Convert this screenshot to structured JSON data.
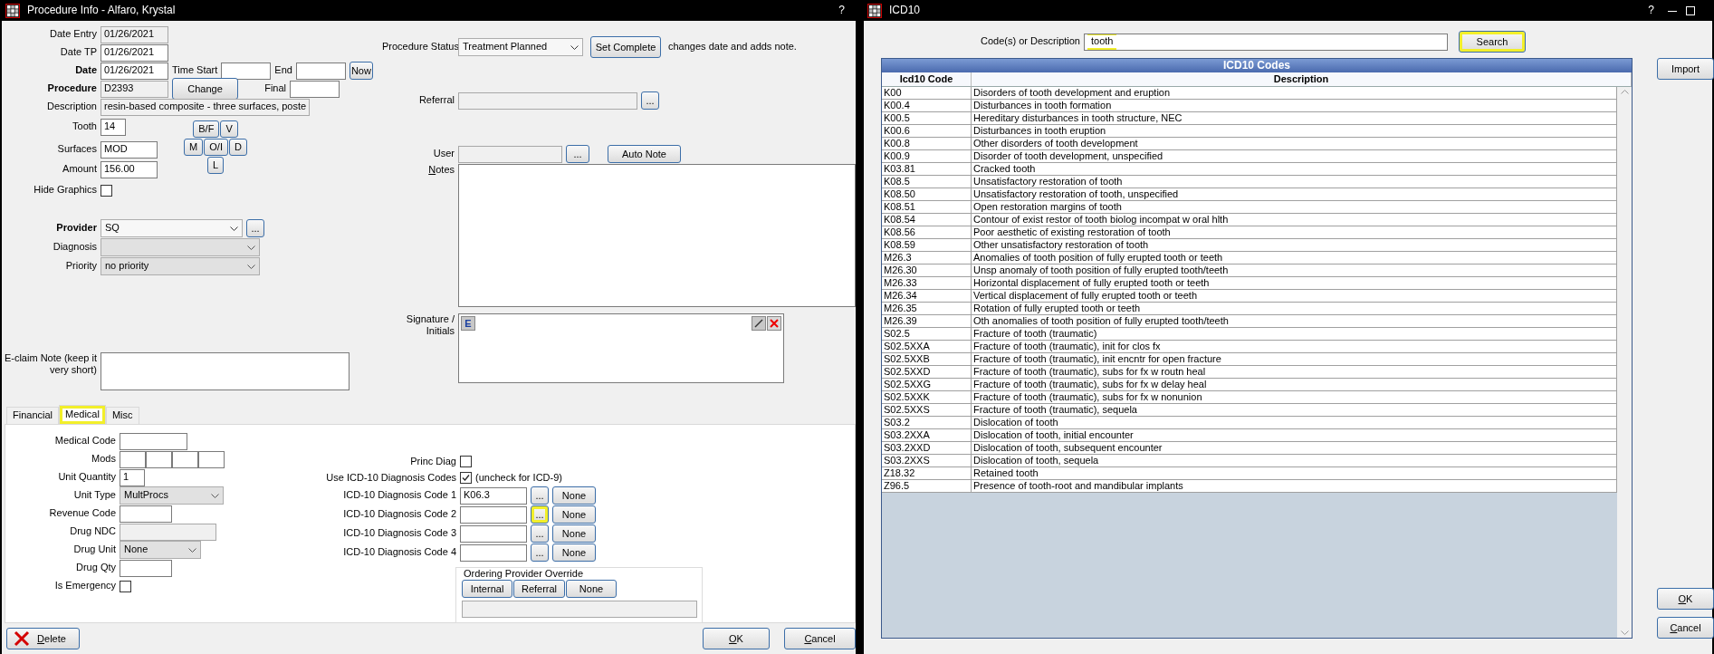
{
  "procedure_info": {
    "title": "Procedure Info - Alfaro, Krystal",
    "help": "?",
    "date_entry": {
      "label": "Date Entry",
      "value": "01/26/2021",
      "bold": false,
      "disabled": true
    },
    "date_tp": {
      "label": "Date TP",
      "value": "01/26/2021",
      "bold": false,
      "disabled": false
    },
    "date": {
      "label": "Date",
      "value": "01/26/2021",
      "bold": true,
      "disabled": false
    },
    "time_start": {
      "label": "Time Start"
    },
    "end": {
      "label": "End"
    },
    "now_button": "Now",
    "procedure": {
      "label": "Procedure",
      "value": "D2393",
      "bold": true,
      "disabled": true
    },
    "change_button": "Change",
    "final": {
      "label": "Final"
    },
    "description": {
      "label": "Description",
      "value": "resin-based composite - three surfaces, poste",
      "bold": false,
      "disabled": true
    },
    "tooth": {
      "label": "Tooth",
      "value": "14",
      "bold": false,
      "disabled": false
    },
    "surface_buttons": [
      [
        "B/F",
        "V"
      ],
      [
        "M",
        "O/I",
        "D"
      ],
      [
        "L"
      ]
    ],
    "surfaces": {
      "label": "Surfaces",
      "value": "MOD",
      "bold": false,
      "disabled": false
    },
    "amount": {
      "label": "Amount",
      "value": "156.00",
      "bold": false,
      "disabled": false
    },
    "hide_graphics": {
      "label": "Hide Graphics",
      "checked": false
    },
    "provider": {
      "label": "Provider",
      "value": "SQ",
      "bold": true,
      "disabled": false
    },
    "provider_picker": "...",
    "diagnosis": {
      "label": "Diagnosis",
      "bold": false,
      "disabled": true
    },
    "priority": {
      "label": "Priority",
      "value": "no priority",
      "bold": false,
      "disabled": true
    },
    "eclaim_note": {
      "label": "E-claim Note (keep it very short)"
    },
    "procedure_status": {
      "label": "Procedure Status",
      "value": "Treatment Planned",
      "disabled": false
    },
    "set_complete_button": "Set Complete",
    "set_complete_hint": "changes date and adds note.",
    "referral": {
      "label": "Referral",
      "disabled": true
    },
    "referral_picker": "...",
    "user": {
      "label": "User",
      "disabled": true
    },
    "user_picker": "...",
    "auto_note_button": "Auto Note",
    "notes": {
      "label": "Notes"
    },
    "signature": {
      "label": "Signature / Initials",
      "e_button": "E"
    },
    "tabs": [
      {
        "label": "Financial",
        "selected": false,
        "highlighted": false
      },
      {
        "label": "Medical",
        "selected": true,
        "highlighted": true
      },
      {
        "label": "Misc",
        "selected": false,
        "highlighted": false
      }
    ],
    "medical": {
      "medical_code": {
        "label": "Medical Code"
      },
      "mods": {
        "label": "Mods",
        "fields": [
          {
            "disabled": false
          },
          {
            "disabled": false
          },
          {
            "disabled": false
          },
          {
            "disabled": false
          }
        ]
      },
      "unit_quantity": {
        "label": "Unit Quantity",
        "value": "1"
      },
      "unit_type": {
        "label": "Unit Type",
        "value": "MultProcs",
        "disabled": true
      },
      "revenue_code": {
        "label": "Revenue Code"
      },
      "drug_ndc": {
        "label": "Drug NDC",
        "disabled": true
      },
      "drug_unit": {
        "label": "Drug Unit",
        "value": "None",
        "disabled": true
      },
      "drug_qty": {
        "label": "Drug Qty"
      },
      "is_emergency": {
        "label": "Is Emergency",
        "checked": false
      },
      "princ_diag": {
        "label": "Princ Diag",
        "checked": false
      },
      "use_icd10": {
        "label": "Use ICD-10 Diagnosis Codes",
        "checked": true,
        "hint": "(uncheck for ICD-9)"
      },
      "diagnosis_codes": [
        {
          "label": "ICD-10 Diagnosis Code 1",
          "value": "K06.3",
          "picker": "...",
          "picker_highlighted": false,
          "clear": "None"
        },
        {
          "label": "ICD-10 Diagnosis Code 2",
          "picker": "...",
          "picker_highlighted": true,
          "clear": "None"
        },
        {
          "label": "ICD-10 Diagnosis Code 3",
          "picker": "...",
          "picker_highlighted": false,
          "clear": "None"
        },
        {
          "label": "ICD-10 Diagnosis Code 4",
          "picker": "...",
          "picker_highlighted": false,
          "clear": "None"
        }
      ],
      "ordering_provider_override": {
        "title": "Ordering Provider Override",
        "buttons": [
          "Internal",
          "Referral",
          "None"
        ]
      }
    },
    "delete_button": "Delete",
    "ok_button": "OK",
    "cancel_button": "Cancel"
  },
  "icd10_window": {
    "title": "ICD10",
    "help": "?",
    "search": {
      "label": "Code(s) or Description",
      "value": "tooth",
      "highlighted": true
    },
    "search_button": {
      "label": "Search",
      "highlighted": true
    },
    "table": {
      "title": "ICD10 Codes",
      "columns": [
        "Icd10 Code",
        "Description"
      ],
      "rows": [
        [
          "K00",
          "Disorders of tooth development and eruption"
        ],
        [
          "K00.4",
          "Disturbances in tooth formation"
        ],
        [
          "K00.5",
          "Hereditary disturbances in tooth structure, NEC"
        ],
        [
          "K00.6",
          "Disturbances in tooth eruption"
        ],
        [
          "K00.8",
          "Other disorders of tooth development"
        ],
        [
          "K00.9",
          "Disorder of tooth development, unspecified"
        ],
        [
          "K03.81",
          "Cracked tooth"
        ],
        [
          "K08.5",
          "Unsatisfactory restoration of tooth"
        ],
        [
          "K08.50",
          "Unsatisfactory restoration of tooth, unspecified"
        ],
        [
          "K08.51",
          "Open restoration margins of tooth"
        ],
        [
          "K08.54",
          "Contour of exist restor of tooth biolog incompat w oral hlth"
        ],
        [
          "K08.56",
          "Poor aesthetic of existing restoration of tooth"
        ],
        [
          "K08.59",
          "Other unsatisfactory restoration of tooth"
        ],
        [
          "M26.3",
          "Anomalies of tooth position of fully erupted tooth or teeth"
        ],
        [
          "M26.30",
          "Unsp anomaly of tooth position of fully erupted tooth/teeth"
        ],
        [
          "M26.33",
          "Horizontal displacement of fully erupted tooth or teeth"
        ],
        [
          "M26.34",
          "Vertical displacement of fully erupted tooth or teeth"
        ],
        [
          "M26.35",
          "Rotation of fully erupted tooth or teeth"
        ],
        [
          "M26.39",
          "Oth anomalies of tooth position of fully erupted tooth/teeth"
        ],
        [
          "S02.5",
          "Fracture of tooth (traumatic)"
        ],
        [
          "S02.5XXA",
          "Fracture of tooth (traumatic), init for clos fx"
        ],
        [
          "S02.5XXB",
          "Fracture of tooth (traumatic), init encntr for open fracture"
        ],
        [
          "S02.5XXD",
          "Fracture of tooth (traumatic), subs for fx w routn heal"
        ],
        [
          "S02.5XXG",
          "Fracture of tooth (traumatic), subs for fx w delay heal"
        ],
        [
          "S02.5XXK",
          "Fracture of tooth (traumatic), subs for fx w nonunion"
        ],
        [
          "S02.5XXS",
          "Fracture of tooth (traumatic), sequela"
        ],
        [
          "S03.2",
          "Dislocation of tooth"
        ],
        [
          "S03.2XXA",
          "Dislocation of tooth, initial encounter"
        ],
        [
          "S03.2XXD",
          "Dislocation of tooth, subsequent encounter"
        ],
        [
          "S03.2XXS",
          "Dislocation of tooth, sequela"
        ],
        [
          "Z18.32",
          "Retained tooth"
        ],
        [
          "Z96.5",
          "Presence of tooth-root and mandibular implants"
        ]
      ]
    },
    "import_button": "Import",
    "ok_button": "OK",
    "cancel_button": "Cancel"
  }
}
